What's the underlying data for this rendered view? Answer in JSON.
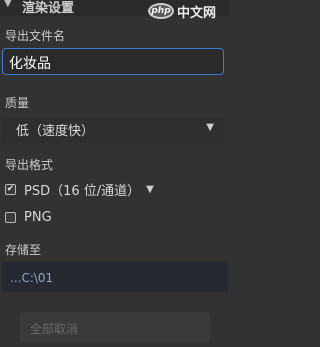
{
  "panel": {
    "title": "渲染设置"
  },
  "watermark": {
    "logo": "php",
    "text": "中文网"
  },
  "filename": {
    "label": "导出文件名",
    "value": "化妆品"
  },
  "quality": {
    "label": "质量",
    "selected": "低（速度快）"
  },
  "format": {
    "label": "导出格式",
    "options": [
      {
        "label": "PSD（16 位/通道）",
        "checked": true
      },
      {
        "label": "PNG",
        "checked": false
      }
    ]
  },
  "save_to": {
    "label": "存储至",
    "path": "...C:\\01"
  },
  "export_button": {
    "label": "全部取消"
  },
  "icons": {
    "expand": "chevron-down-icon",
    "checkbox": "check-icon"
  }
}
